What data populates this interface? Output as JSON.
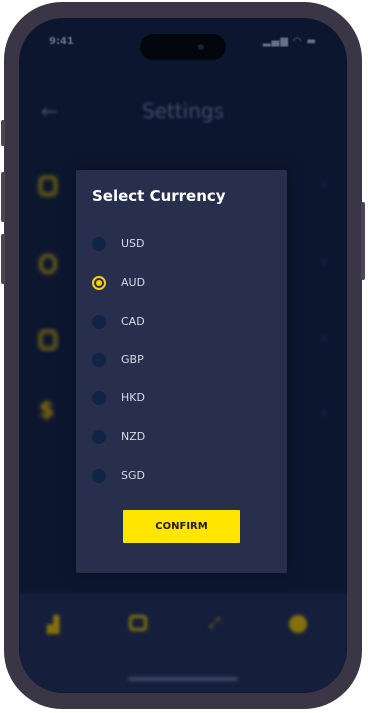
{
  "status": {
    "time": "9:41"
  },
  "header": {
    "title": "Settings",
    "back_icon": "arrow-left-icon"
  },
  "settings_rows": [
    {
      "icon": "shield-icon"
    },
    {
      "icon": "refresh-icon"
    },
    {
      "icon": "trash-icon"
    },
    {
      "icon": "dollar-icon"
    }
  ],
  "dialog": {
    "title": "Select Currency",
    "options": [
      {
        "label": "USD",
        "selected": false
      },
      {
        "label": "AUD",
        "selected": true
      },
      {
        "label": "CAD",
        "selected": false
      },
      {
        "label": "GBP",
        "selected": false
      },
      {
        "label": "HKD",
        "selected": false
      },
      {
        "label": "NZD",
        "selected": false
      },
      {
        "label": "SGD",
        "selected": false
      }
    ],
    "confirm_label": "CONFIRM"
  },
  "bottom_nav": [
    {
      "icon": "chart-icon"
    },
    {
      "icon": "wallet-icon"
    },
    {
      "icon": "transfer-icon"
    },
    {
      "icon": "globe-icon"
    }
  ],
  "colors": {
    "accent": "#ffe500",
    "background": "#0f1a35",
    "dialog": "#272f4d"
  }
}
